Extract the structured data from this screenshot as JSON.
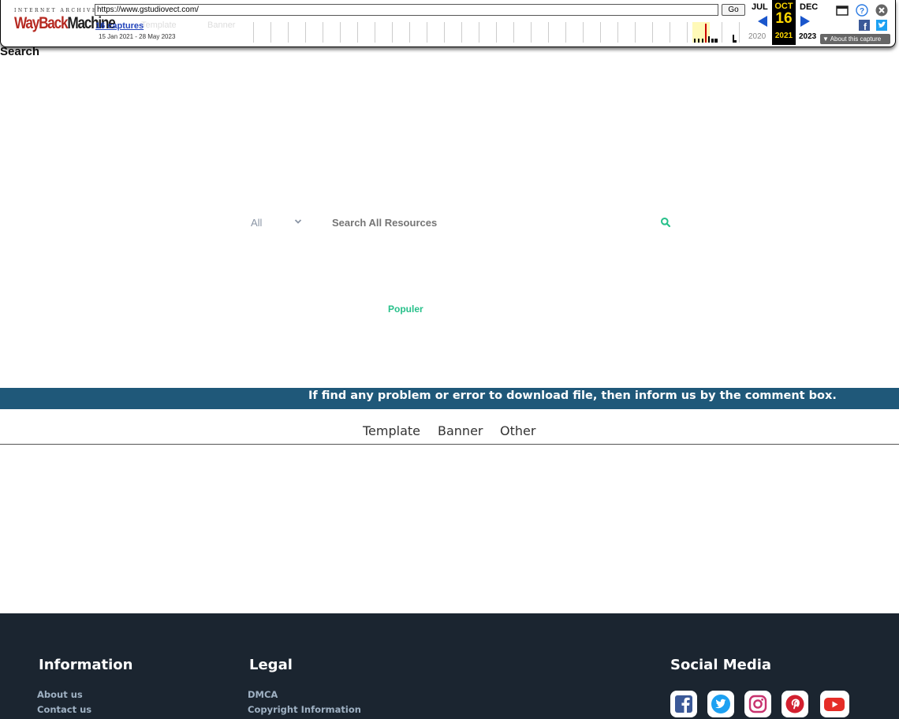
{
  "wayback": {
    "logo_top": "INTERNET ARCHIVE",
    "logo_way": "WayBack",
    "logo_machine": "Machine",
    "url": "https://www.gstudiovect.com/",
    "go_label": "Go",
    "captures_label": "16 captures",
    "date_range": "15 Jan 2021 - 28 May 2023",
    "ghost_template": "Template",
    "ghost_banner": "Banner",
    "prev_month": "JUL",
    "cur_month": "OCT",
    "cur_day": "16",
    "next_month": "DEC",
    "prev_year": "2020",
    "cur_year": "2021",
    "next_year": "2023",
    "about_label": "About this capture"
  },
  "page": {
    "search_heading": "Search",
    "category_select": "All",
    "search_placeholder": "Search All Resources",
    "populer_label": "Populer",
    "notice_text": "If find any problem or error to download file, then inform us by the comment box.",
    "nav": [
      "Template",
      "Banner",
      "Other"
    ]
  },
  "footer": {
    "info_heading": "Information",
    "info_links": [
      "About us",
      "Contact us"
    ],
    "legal_heading": "Legal",
    "legal_links": [
      "DMCA",
      "Copyright Information"
    ],
    "social_heading": "Social Media",
    "social_icons": [
      "facebook-icon",
      "twitter-icon",
      "instagram-icon",
      "pinterest-icon",
      "youtube-icon"
    ]
  },
  "colors": {
    "notice_bg": "#1f5879",
    "footer_bg": "#1b2530",
    "accent_green": "#27c08a",
    "link_muted": "#9fb1c3"
  }
}
